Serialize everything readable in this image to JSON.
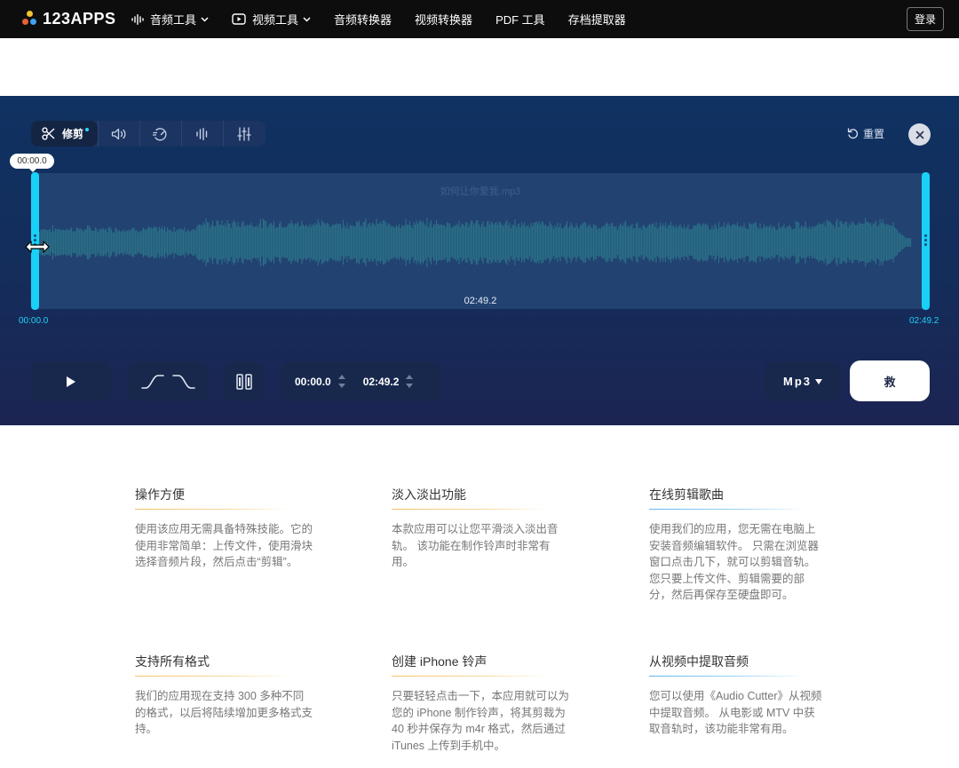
{
  "brand": {
    "name": "123APPS"
  },
  "nav": {
    "items": [
      {
        "label": "音频工具",
        "icon": "audio-wave-icon",
        "dropdown": true
      },
      {
        "label": "视频工具",
        "icon": "video-play-icon",
        "dropdown": true
      },
      {
        "label": "音频转换器"
      },
      {
        "label": "视频转换器"
      },
      {
        "label": "PDF 工具"
      },
      {
        "label": "存档提取器"
      }
    ],
    "login_label": "登录"
  },
  "editor": {
    "tabs": [
      {
        "label": "修剪",
        "icon": "scissors-icon",
        "active": true
      },
      {
        "icon": "volume-icon"
      },
      {
        "icon": "speed-icon"
      },
      {
        "icon": "equalizer-bars-icon"
      },
      {
        "icon": "mixer-sliders-icon"
      }
    ],
    "reset_label": "重置",
    "file_name": "如何让你爱我.mp3",
    "duration_center": "02:49.2",
    "bubble_time": "00:00.0",
    "start_label": "00:00.0",
    "end_label": "02:49.2",
    "start_input": "00:00.0",
    "end_input": "02:49.2",
    "format_label": "Mp3",
    "save_label": "救"
  },
  "features": [
    {
      "title": "操作方便",
      "text": "使用该应用无需具备特殊技能。它的使用非常简单：上传文件，使用滑块选择音频片段，然后点击“剪辑”。",
      "accent": "#f4c266"
    },
    {
      "title": "淡入淡出功能",
      "text": "本款应用可以让您平滑淡入淡出音轨。 该功能在制作铃声时非常有用。",
      "accent": "#f4c266"
    },
    {
      "title": "在线剪辑歌曲",
      "text": "使用我们的应用，您无需在电脑上安装音频编辑软件。 只需在浏览器窗口点击几下，就可以剪辑音轨。 您只要上传文件、剪辑需要的部分，然后再保存至硬盘即可。",
      "accent": "#5db7f0"
    },
    {
      "title": "支持所有格式",
      "text": "我们的应用现在支持 300 多种不同的格式，以后将陆续增加更多格式支持。",
      "accent": "#f4c266"
    },
    {
      "title": "创建 iPhone 铃声",
      "text": "只要轻轻点击一下，本应用就可以为您的 iPhone 制作铃声，将其剪裁为 40 秒并保存为 m4r 格式，然后通过 iTunes 上传到手机中。",
      "accent": "#f4c266"
    },
    {
      "title": "从视频中提取音频",
      "text": "您可以使用《Audio Cutter》从视频中提取音频。 从电影或 MTV 中获取音轨时，该功能非常有用。",
      "accent": "#5db7f0"
    }
  ],
  "colors": {
    "topbar": "#0d0d0d",
    "editor_bg": "#142d5b",
    "handle": "#19d0f6",
    "waveform": "#2a6f86"
  }
}
